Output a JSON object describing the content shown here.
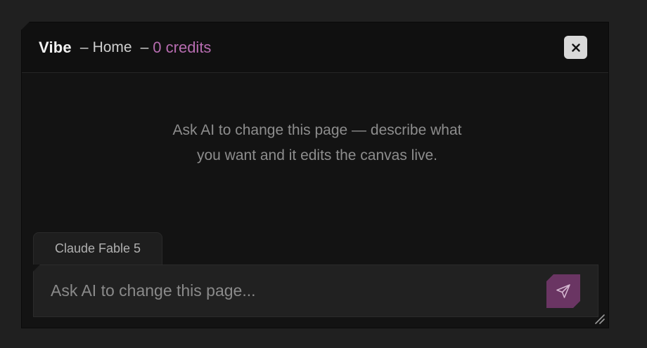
{
  "header": {
    "title": "Vibe",
    "separator_1": "–",
    "page_name": "Home",
    "separator_2": "–",
    "credits": "0 credits",
    "close_icon": "close-icon"
  },
  "empty_state": {
    "message": "Ask AI to change this page — describe what you want and it edits the canvas live."
  },
  "model_selector": {
    "label": "Claude Fable 5"
  },
  "composer": {
    "placeholder": "Ask AI to change this page...",
    "value": "",
    "send_icon": "send-icon"
  },
  "colors": {
    "accent": "#b76cb0",
    "send_button": "#6a3563",
    "panel_background": "#131313",
    "page_background": "#202020"
  }
}
